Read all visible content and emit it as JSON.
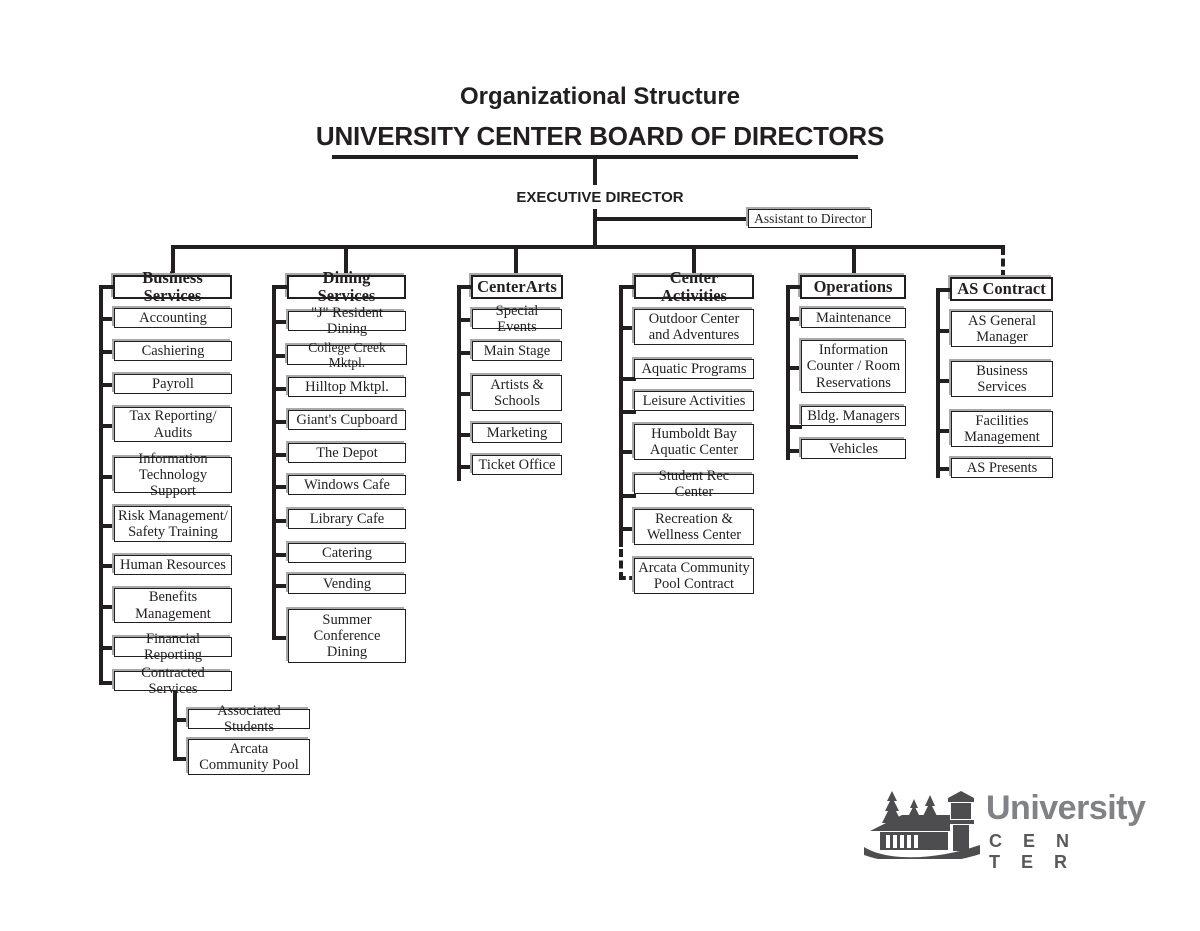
{
  "header": {
    "subtitle": "Organizational Structure",
    "title": "UNIVERSITY CENTER BOARD OF DIRECTORS",
    "executive": "EXECUTIVE DIRECTOR",
    "assistant": "Assistant to Director"
  },
  "logo": {
    "word": "University",
    "word_sub": "C E N T E R",
    "icon": "university-center-building-logo",
    "color_word": "#808285",
    "color_sub": "#58595b"
  },
  "colors": {
    "line": "#231f20",
    "shadow": "#a7a9ac",
    "background": "#ffffff"
  },
  "chart_data": {
    "type": "org-chart",
    "root": "UNIVERSITY CENTER BOARD OF DIRECTORS",
    "second_level": "EXECUTIVE DIRECTOR",
    "staff": "Assistant to Director",
    "columns": [
      {
        "id": "business-services",
        "head": "Business Services",
        "dashed": false,
        "children": [
          "Accounting",
          "Cashiering",
          "Payroll",
          "Tax Reporting/\nAudits",
          "Information\nTechnology Support",
          "Risk Management/\nSafety Training",
          "Human Resources",
          "Benefits\nManagement",
          "Financial Reporting",
          "Contracted Services"
        ],
        "sub_parent": "Contracted Services",
        "sub_children": [
          "Associated Students",
          "Arcata\nCommunity Pool"
        ]
      },
      {
        "id": "dining-services",
        "head": "Dining Services",
        "dashed": false,
        "children": [
          "\"J\" Resident Dining",
          "College Creek Mktpl.",
          "Hilltop Mktpl.",
          "Giant's Cupboard",
          "The Depot",
          "Windows Cafe",
          "Library Cafe",
          "Catering",
          "Vending",
          "Summer\nConference\nDining"
        ]
      },
      {
        "id": "centerarts",
        "head": "CenterArts",
        "dashed": false,
        "children": [
          "Special Events",
          "Main Stage",
          "Artists &\nSchools",
          "Marketing",
          "Ticket Office"
        ]
      },
      {
        "id": "center-activities",
        "head": "Center Activities",
        "dashed": false,
        "children": [
          "Outdoor Center\nand Adventures",
          "Aquatic Programs",
          "Leisure Activities",
          "Humboldt Bay\nAquatic Center",
          "Student Rec Center",
          "Recreation &\nWellness Center"
        ],
        "dashed_child": "Arcata Community\nPool Contract"
      },
      {
        "id": "operations",
        "head": "Operations",
        "dashed": false,
        "children": [
          "Maintenance",
          "Information\nCounter / Room\nReservations",
          "Bldg. Managers",
          "Vehicles"
        ]
      },
      {
        "id": "as-contract",
        "head": "AS Contract",
        "dashed": true,
        "children": [
          "AS General\nManager",
          "Business\nServices",
          "Facilities\nManagement",
          "AS Presents"
        ]
      }
    ]
  }
}
